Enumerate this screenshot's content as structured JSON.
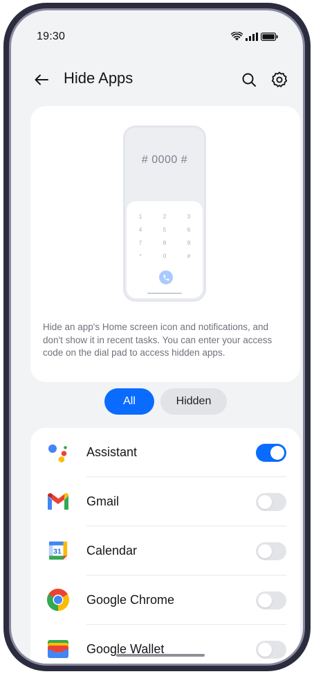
{
  "status_bar": {
    "time": "19:30",
    "icons": [
      "wifi-icon",
      "signal-icon",
      "battery-icon"
    ]
  },
  "header": {
    "title": "Hide Apps",
    "icons": [
      "back-arrow-icon",
      "search-icon",
      "gear-icon"
    ]
  },
  "illustration": {
    "code": "# 0000 #",
    "dialpad_keys": [
      [
        "1",
        "2",
        "3"
      ],
      [
        "4",
        "5",
        "6"
      ],
      [
        "7",
        "8",
        "9"
      ],
      [
        "*",
        "0",
        "#"
      ]
    ]
  },
  "info": {
    "description": "Hide an app's Home screen icon and notifications, and don't show it in recent tasks. You can enter your access code on the dial pad to access hidden apps."
  },
  "tabs": [
    {
      "label": "All",
      "selected": true
    },
    {
      "label": "Hidden",
      "selected": false
    }
  ],
  "apps": [
    {
      "name": "Assistant",
      "icon": "assistant-icon",
      "hidden": true
    },
    {
      "name": "Gmail",
      "icon": "gmail-icon",
      "hidden": false
    },
    {
      "name": "Calendar",
      "icon": "calendar-icon",
      "hidden": false,
      "icon_text": "31"
    },
    {
      "name": "Google Chrome",
      "icon": "chrome-icon",
      "hidden": false
    },
    {
      "name": "Google Wallet",
      "icon": "wallet-icon",
      "hidden": false
    }
  ],
  "colors": {
    "accent": "#0a6cff",
    "background": "#f2f3f5",
    "card": "#ffffff",
    "toggle_off": "#e3e4e7"
  }
}
